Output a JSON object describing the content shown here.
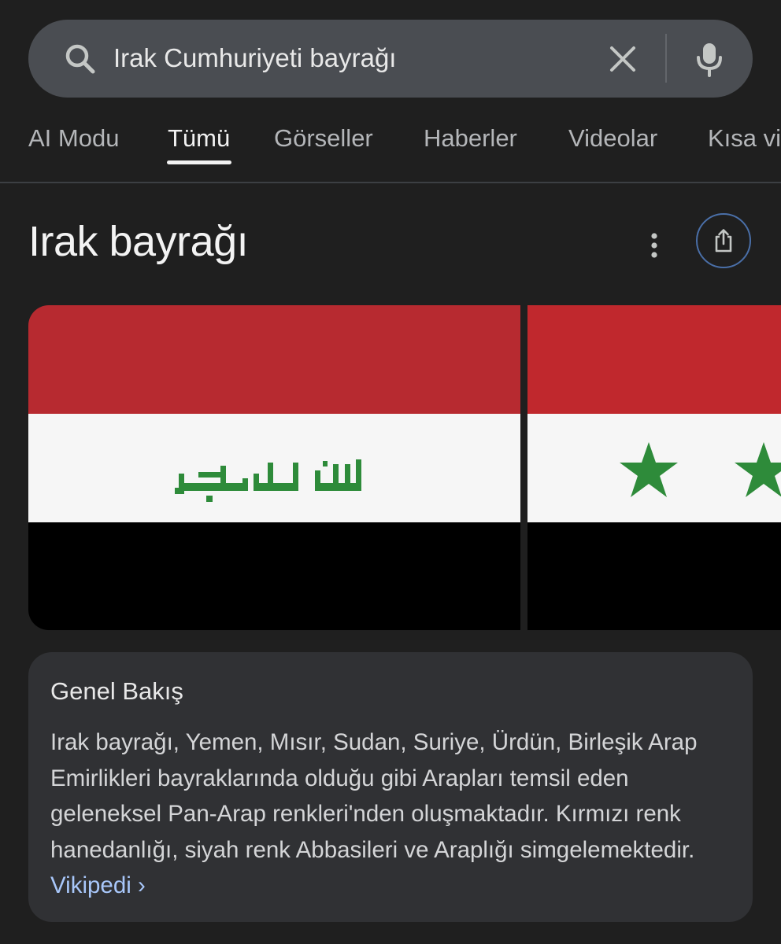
{
  "search": {
    "query": "Irak Cumhuriyeti bayrağı",
    "icons": {
      "search": "search-icon",
      "clear": "close-icon",
      "mic": "mic-icon"
    }
  },
  "tabs": [
    {
      "label": "AI Modu",
      "active": false
    },
    {
      "label": "Tümü",
      "active": true
    },
    {
      "label": "Görseller",
      "active": false
    },
    {
      "label": "Haberler",
      "active": false
    },
    {
      "label": "Videolar",
      "active": false
    },
    {
      "label": "Kısa vi",
      "active": false
    }
  ],
  "knowledge_panel": {
    "title": "Irak bayrağı",
    "actions": {
      "more": "more-vert-icon",
      "share": "share-icon"
    },
    "images": [
      {
        "flag": "Iraq",
        "stripes": [
          "#b72a30",
          "#f6f6f6",
          "#000000"
        ],
        "emblem_color": "#2e8b3a"
      },
      {
        "flag": "Iraq (former)",
        "stripes": [
          "#c0282d",
          "#f6f6f6",
          "#000000"
        ],
        "star_color": "#2e8b3a"
      }
    ]
  },
  "overview": {
    "title": "Genel Bakış",
    "text": "Irak bayrağı, Yemen, Mısır, Sudan, Suriye, Ürdün, Birleşik Arap Emirlikleri bayraklarında olduğu gibi Arapları temsil eden geleneksel Pan-Arap renkleri'nden oluşmaktadır. Kırmızı renk hanedanlığı, siyah renk Abbasileri ve Araplığı simgelemektedir.",
    "source_link": "Vikipedi ›"
  },
  "colors": {
    "background": "#1f1f1f",
    "search_bar": "#4a4d52",
    "card": "#303134",
    "link": "#a8c7fa"
  }
}
